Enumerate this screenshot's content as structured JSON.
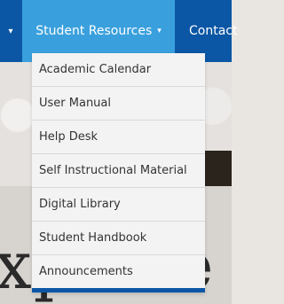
{
  "nav": {
    "left_caret": "▾",
    "active_item": "Student Resources",
    "active_caret": "▾",
    "contact": "Contact"
  },
  "dropdown": {
    "items": [
      {
        "label": "Academic Calendar"
      },
      {
        "label": "User Manual"
      },
      {
        "label": "Help Desk"
      },
      {
        "label": "Self Instructional Material"
      },
      {
        "label": "Digital Library"
      },
      {
        "label": "Student Handbook"
      },
      {
        "label": "Announcements"
      }
    ]
  },
  "hero": {
    "word": "xplore"
  },
  "colors": {
    "navbar": "#0b57a5",
    "active_nav": "#3aa0dd",
    "dropdown_bg": "#f3f3f3",
    "dropdown_bottom": "#0b57a5"
  }
}
